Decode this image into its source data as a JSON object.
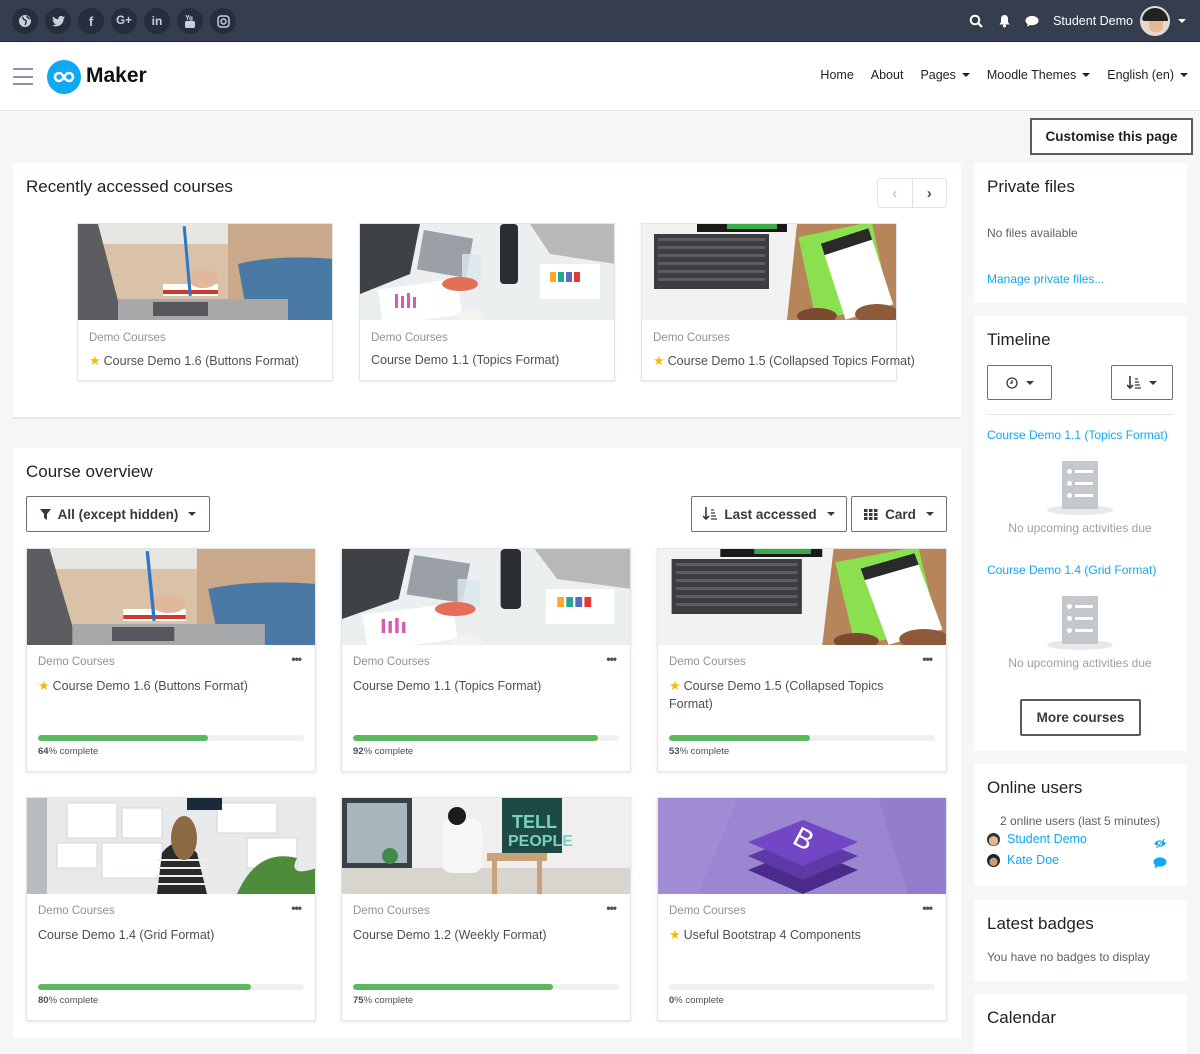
{
  "topbar": {
    "social": [
      {
        "icon": "globe-icon",
        "glyph": "◍"
      },
      {
        "icon": "twitter-icon",
        "glyph": "🐦"
      },
      {
        "icon": "facebook-icon",
        "glyph": "f"
      },
      {
        "icon": "google-plus-icon",
        "glyph": "G+"
      },
      {
        "icon": "linkedin-icon",
        "glyph": "in"
      },
      {
        "icon": "youtube-icon",
        "glyph": "▶"
      },
      {
        "icon": "instagram-icon",
        "glyph": "◎"
      }
    ],
    "user_name": "Student Demo"
  },
  "navbar": {
    "brand": "Maker",
    "menu": [
      {
        "label": "Home",
        "dropdown": false
      },
      {
        "label": "About",
        "dropdown": false
      },
      {
        "label": "Pages",
        "dropdown": true
      },
      {
        "label": "Moodle Themes",
        "dropdown": true
      },
      {
        "label": "English (en)",
        "dropdown": true
      }
    ]
  },
  "customise_button": "Customise this page",
  "recent": {
    "title": "Recently accessed courses",
    "courses": [
      {
        "category": "Demo Courses",
        "name": "Course Demo 1.6 (Buttons Format)",
        "starred": true,
        "image": "laptop-writing"
      },
      {
        "category": "Demo Courses",
        "name": "Course Demo 1.1 (Topics Format)",
        "starred": false,
        "image": "meeting-table"
      },
      {
        "category": "Demo Courses",
        "name": "Course Demo 1.5 (Collapsed Topics Format)",
        "starred": true,
        "image": "laptop-notepad"
      }
    ]
  },
  "overview": {
    "title": "Course overview",
    "filter": "All (except hidden)",
    "sort": "Last accessed",
    "view": "Card",
    "progress_suffix": "% complete",
    "courses": [
      {
        "category": "Demo Courses",
        "name": "Course Demo 1.6 (Buttons Format)",
        "starred": true,
        "progress": 64,
        "image": "laptop-writing"
      },
      {
        "category": "Demo Courses",
        "name": "Course Demo 1.1 (Topics Format)",
        "starred": false,
        "progress": 92,
        "image": "meeting-table"
      },
      {
        "category": "Demo Courses",
        "name": "Course Demo 1.5 (Collapsed Topics Format)",
        "starred": true,
        "progress": 53,
        "image": "laptop-notepad"
      },
      {
        "category": "Demo Courses",
        "name": "Course Demo 1.4 (Grid Format)",
        "starred": false,
        "progress": 80,
        "image": "wall-board"
      },
      {
        "category": "Demo Courses",
        "name": "Course Demo 1.2 (Weekly Format)",
        "starred": false,
        "progress": 75,
        "image": "woman-reading"
      },
      {
        "category": "Demo Courses",
        "name": "Useful Bootstrap 4 Components",
        "starred": true,
        "progress": 0,
        "image": "bootstrap-logo"
      }
    ]
  },
  "private_files": {
    "title": "Private files",
    "empty": "No files available",
    "manage_link": "Manage private files..."
  },
  "timeline": {
    "title": "Timeline",
    "courses": [
      {
        "name": "Course Demo 1.1 (Topics Format)",
        "empty": "No upcoming activities due"
      },
      {
        "name": "Course Demo 1.4 (Grid Format)",
        "empty": "No upcoming activities due"
      }
    ],
    "more_button": "More courses"
  },
  "online_users": {
    "title": "Online users",
    "summary": "2 online users (last 5 minutes)",
    "users": [
      {
        "name": "Student Demo",
        "action_icon": "eye-slash-icon"
      },
      {
        "name": "Kate Doe",
        "action_icon": "message-icon"
      }
    ]
  },
  "badges": {
    "title": "Latest badges",
    "empty": "You have no badges to display"
  },
  "calendar": {
    "title": "Calendar"
  },
  "colors": {
    "accent": "#0fa8f2",
    "topbar": "#353e4f",
    "progress": "#5cb85c",
    "star": "#f6b90a"
  }
}
